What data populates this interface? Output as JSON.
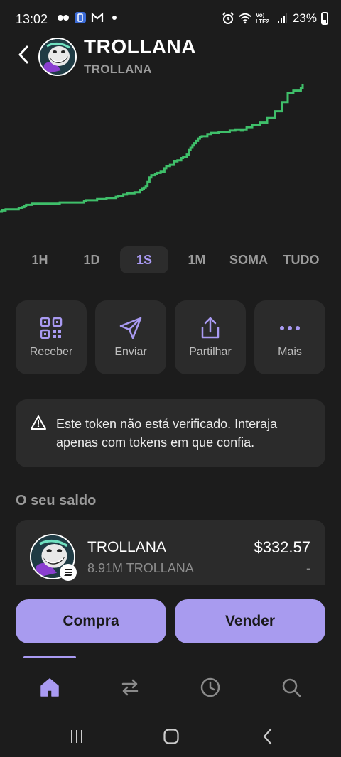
{
  "status_bar": {
    "time": "13:02",
    "left_icons": [
      "messenger-icon",
      "app-icon",
      "gmail-icon",
      "dot-icon"
    ],
    "right_icons": [
      "alarm-icon",
      "wifi-icon",
      "lte-icon",
      "signal-icon",
      "battery-icon"
    ],
    "lte_label": "Vo) LTE2",
    "battery": "23%"
  },
  "header": {
    "title": "TROLLANA",
    "subtitle": "TROLLANA"
  },
  "chart_data": {
    "type": "line",
    "color": "#3fbf6a",
    "values": [
      0,
      0.5,
      0.5,
      1,
      1,
      1,
      1,
      1,
      1,
      1,
      1.5,
      1.5,
      2,
      2.5,
      3,
      3,
      3,
      3.5,
      3.5,
      3.5,
      3.5,
      3.5,
      3.5,
      3.5,
      3.5,
      3.5,
      3.5,
      3.5,
      3.5,
      3.5,
      3.5,
      3.5,
      4,
      4,
      4,
      4,
      4,
      4,
      4,
      4,
      4,
      4,
      4,
      4,
      4,
      4.5,
      5,
      5,
      5,
      5,
      5,
      5,
      5.5,
      5.5,
      5.5,
      5.5,
      5.5,
      6,
      6,
      6,
      6,
      6,
      6.5,
      7,
      7,
      7,
      7.5,
      7.5,
      8,
      8,
      8,
      8,
      8.5,
      8.5,
      8.5,
      9.5,
      10,
      10.5,
      11,
      13,
      15,
      16,
      16,
      16.5,
      17,
      17,
      17.5,
      17.5,
      19,
      20,
      20,
      20.5,
      20.5,
      22,
      22,
      22.5,
      22.5,
      23.5,
      24,
      24,
      25,
      27,
      28,
      29,
      30,
      31,
      32,
      32.5,
      33,
      33,
      33,
      34,
      34,
      34.5,
      34.5,
      34.5,
      34.5,
      35,
      35,
      35,
      35,
      35,
      35,
      35.5,
      35.5,
      35.5,
      36,
      36,
      36,
      35.5,
      36,
      36,
      37,
      37,
      37,
      38,
      38,
      38,
      38,
      39,
      39,
      39,
      39,
      41,
      41,
      41,
      41,
      44,
      44,
      44,
      44,
      48,
      48,
      48,
      52,
      52,
      52,
      53,
      53,
      53,
      53,
      54,
      56
    ],
    "xlabel": "",
    "ylabel": ""
  },
  "range_tabs": {
    "items": [
      "1H",
      "1D",
      "1S",
      "1M",
      "SOMA",
      "TUDO"
    ],
    "selected": "1S"
  },
  "actions": [
    {
      "label": "Receber",
      "icon": "qr-code-icon"
    },
    {
      "label": "Enviar",
      "icon": "send-icon"
    },
    {
      "label": "Partilhar",
      "icon": "share-icon"
    },
    {
      "label": "Mais",
      "icon": "more-dots-icon"
    }
  ],
  "warning": {
    "icon": "warning-triangle-icon",
    "text": "Este token não está verificado. Interaja apenas com tokens em que confia."
  },
  "balance": {
    "heading": "O seu saldo",
    "token_name": "TROLLANA",
    "amount": "8.91M TROLLANA",
    "value": "$332.57",
    "change": "-"
  },
  "cta": {
    "buy": "Compra",
    "sell": "Vender",
    "color": "#a89bef"
  },
  "bottom_nav": {
    "items": [
      "home-icon",
      "swap-icon",
      "history-icon",
      "search-icon"
    ],
    "active": "home-icon",
    "accent": "#a99af2"
  },
  "system_nav": [
    "recents-icon",
    "home-circle-icon",
    "back-icon"
  ]
}
